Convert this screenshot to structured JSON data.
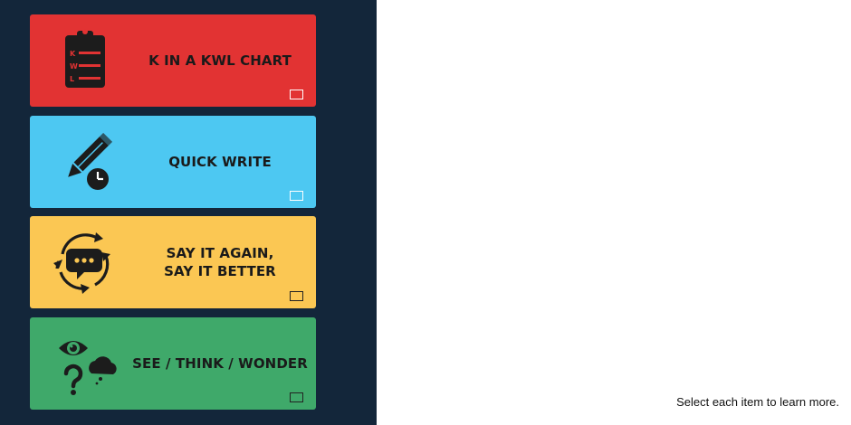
{
  "cards": [
    {
      "label": "K IN A KWL CHART",
      "icon": "kwl-clipboard-icon",
      "color": "#e23333",
      "kwl_letters": [
        "K",
        "W",
        "L"
      ]
    },
    {
      "label": "QUICK WRITE",
      "icon": "pencil-clock-icon",
      "color": "#4dc8f2"
    },
    {
      "label": "SAY IT AGAIN,\nSAY IT BETTER",
      "icon": "speech-cycle-icon",
      "color": "#fbc753"
    },
    {
      "label": "SEE / THINK / WONDER",
      "icon": "eye-cloud-question-icon",
      "color": "#3fa96a"
    }
  ],
  "panel_color": "#13263a",
  "instruction": "Select each item to learn more."
}
